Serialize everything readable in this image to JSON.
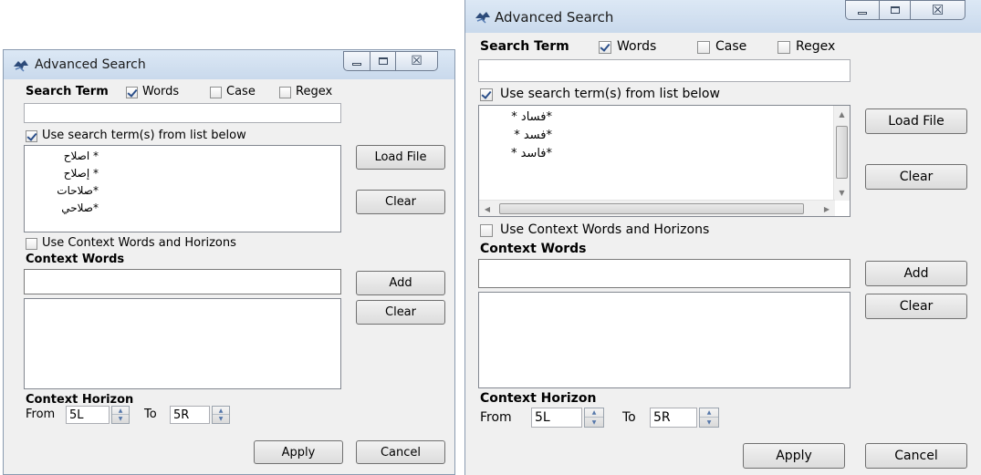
{
  "left_dialog": {
    "title": "Advanced Search",
    "search_term_label": "Search Term",
    "words_label": "Words",
    "case_label": "Case",
    "regex_label": "Regex",
    "search_value": "",
    "use_list_label": "Use search term(s) from list below",
    "terms": [
      "* اصلاح",
      "* إصلاح",
      "*صلاحات",
      "*صلاحي"
    ],
    "load_file_label": "Load File",
    "clear_terms_label": "Clear",
    "use_context_label": "Use Context Words and Horizons",
    "context_words_label": "Context Words",
    "context_value": "",
    "add_label": "Add",
    "clear_context_label": "Clear",
    "context_horizon_label": "Context Horizon",
    "from_label": "From",
    "from_value": "5L",
    "to_label": "To",
    "to_value": "5R",
    "apply_label": "Apply",
    "cancel_label": "Cancel",
    "close_glyph": "☒"
  },
  "right_dialog": {
    "title": "Advanced Search",
    "search_term_label": "Search Term",
    "words_label": "Words",
    "case_label": "Case",
    "regex_label": "Regex",
    "search_value": "",
    "use_list_label": "Use search term(s) from list below",
    "terms": [
      "*فساد *",
      "*فسد *",
      "*فاسد *"
    ],
    "load_file_label": "Load File",
    "clear_terms_label": "Clear",
    "use_context_label": "Use Context Words and Horizons",
    "context_words_label": "Context Words",
    "context_value": "",
    "add_label": "Add",
    "clear_context_label": "Clear",
    "context_horizon_label": "Context Horizon",
    "from_label": "From",
    "from_value": "5L",
    "to_label": "To",
    "to_value": "5R",
    "apply_label": "Apply",
    "cancel_label": "Cancel",
    "close_glyph": "☒"
  }
}
